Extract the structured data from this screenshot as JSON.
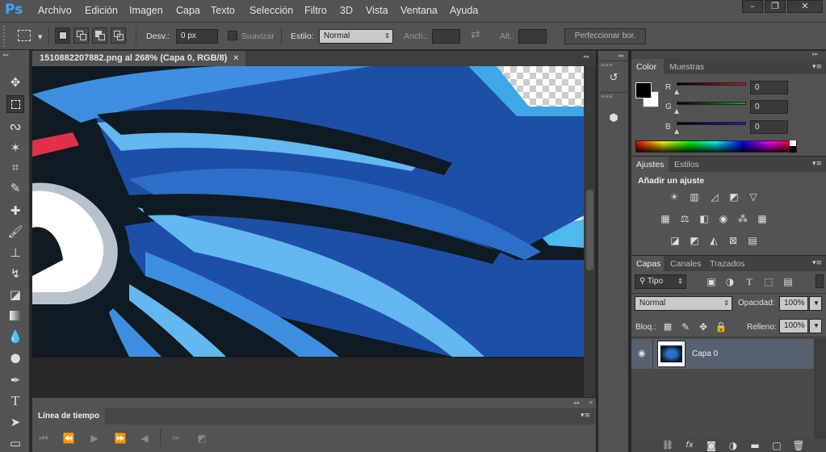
{
  "app": {
    "logo": "Ps"
  },
  "menu": [
    "Archivo",
    "Edición",
    "Imagen",
    "Capa",
    "Texto",
    "Selección",
    "Filtro",
    "3D",
    "Vista",
    "Ventana",
    "Ayuda"
  ],
  "window_controls": {
    "minimize": "–",
    "restore": "❐",
    "close": "✕"
  },
  "options": {
    "feather_label": "Desv.:",
    "feather_value": "0 px",
    "antialias_label": "Suavizar",
    "style_label": "Estilo:",
    "style_value": "Normal",
    "width_label": "Anch.:",
    "height_label": "Alt.:",
    "refine_button": "Perfeccionar bor."
  },
  "document": {
    "tab_title": "1510882207882.png al 268% (Capa 0, RGB/8)",
    "close": "×"
  },
  "timeline": {
    "title": "Línea de tiempo"
  },
  "color_panel": {
    "tabs": [
      "Color",
      "Muestras"
    ],
    "r_label": "R",
    "g_label": "G",
    "b_label": "B",
    "r_value": "0",
    "g_value": "0",
    "b_value": "0",
    "r_color": "#cc1f1f",
    "g_color": "#1fa31f",
    "b_color": "#1f1fcc"
  },
  "adjust_panel": {
    "tabs": [
      "Ajustes",
      "Estilos"
    ],
    "heading": "Añadir un ajuste"
  },
  "layers_panel": {
    "tabs": [
      "Capas",
      "Canales",
      "Trazados"
    ],
    "filter_kind": "Tipo",
    "blend_mode": "Normal",
    "opacity_label": "Opacidad:",
    "opacity_value": "100%",
    "lock_label": "Bloq.:",
    "fill_label": "Relleno:",
    "fill_value": "100%",
    "layers": [
      {
        "name": "Capa 0"
      }
    ]
  }
}
